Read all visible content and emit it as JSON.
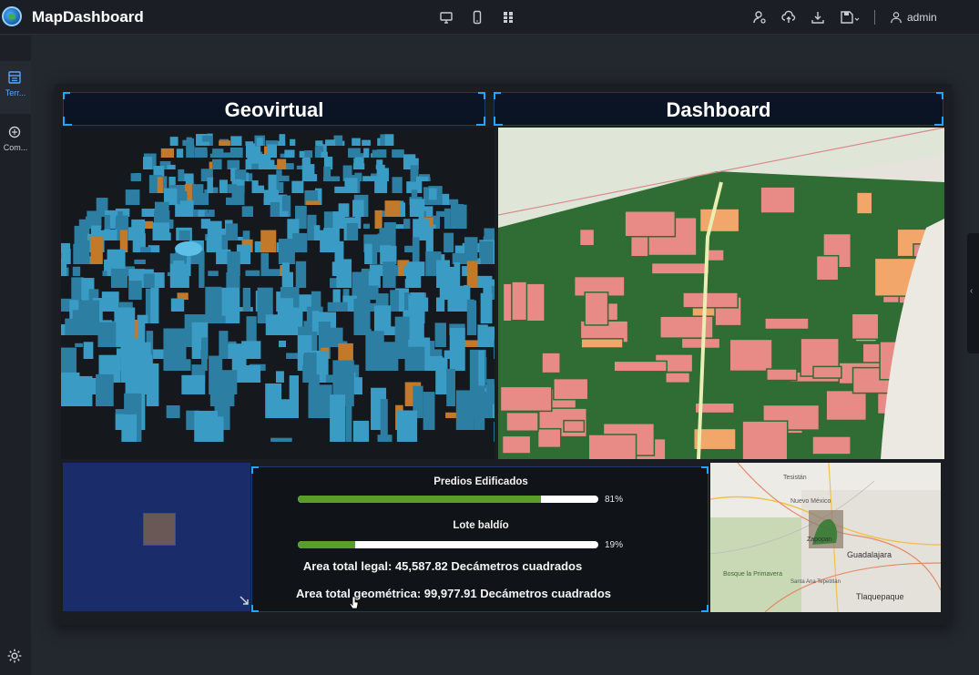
{
  "app": {
    "title": "MapDashboard"
  },
  "topbar": {
    "center_icons": [
      "monitor-icon",
      "phone-icon",
      "grid-icon"
    ],
    "right_icons": [
      "user-pin-icon",
      "upload-icon",
      "download-icon",
      "save-icon"
    ],
    "user_name": "admin"
  },
  "sidebar": {
    "items": [
      {
        "label": "Terr...",
        "icon": "layout-icon"
      },
      {
        "label": "Com...",
        "icon": "component-icon"
      }
    ],
    "bottom_icon": "settings-icon"
  },
  "panels": {
    "left_title": "Geovirtual",
    "right_title": "Dashboard"
  },
  "stats": {
    "bars": [
      {
        "title": "Predios Edificados",
        "value": 0.81,
        "pct_label": "81%"
      },
      {
        "title": "Lote baldío",
        "value": 0.19,
        "pct_label": "19%"
      }
    ],
    "area_legal": "Area total legal: 45,587.82 Decámetros cuadrados",
    "area_geom": "Area total geométrica: 99,977.91 Decámetros cuadrados"
  },
  "mini_map": {
    "places": [
      "Tesistán",
      "Nuevo México",
      "Zapopan",
      "Guadalajara",
      "Bosque la Primavera",
      "Santa Ana Tepetitlán",
      "Tlaquepaque"
    ]
  },
  "colors": {
    "accent": "#21a5ff",
    "bar_fill": "#5a9e2a",
    "buildings": "#3a9cc4",
    "parcels": "#e88b86",
    "green_lines": "#2f7a2f"
  }
}
